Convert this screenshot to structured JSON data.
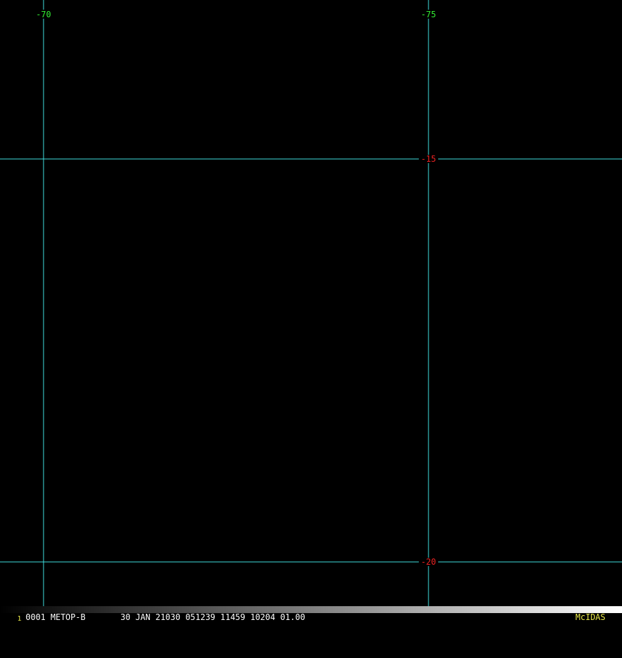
{
  "colors": {
    "background": "#000000",
    "grid_line": "#40e0e0",
    "longitude_label": "#33ee33",
    "latitude_label": "#ee2222",
    "frame_number": "#e8e84a",
    "status_text": "#ffffff",
    "brand": "#e8e84a"
  },
  "graticule": {
    "longitude_lines": [
      {
        "value": -70,
        "label": "-70"
      },
      {
        "value": -75,
        "label": "-75"
      }
    ],
    "latitude_lines": [
      {
        "value": -15,
        "label": "-15"
      },
      {
        "value": -20,
        "label": "-20"
      }
    ]
  },
  "status_bar": {
    "frame_number": "1",
    "info": "0001 METOP-B       30 JAN 21030 051239 11459 10204 01.00",
    "brand": "McIDAS"
  },
  "gray_ramp": {
    "from": "#000000",
    "to": "#ffffff"
  }
}
